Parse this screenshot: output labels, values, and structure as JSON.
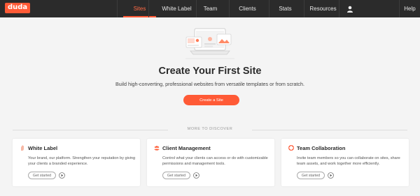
{
  "nav": {
    "logo": "duda",
    "items": [
      {
        "label": "Sites",
        "active": true
      },
      {
        "label": "White Label",
        "active": false
      },
      {
        "label": "Team",
        "active": false
      },
      {
        "label": "Clients",
        "active": false
      },
      {
        "label": "Stats",
        "active": false
      },
      {
        "label": "Resources",
        "active": false
      }
    ],
    "user_icon": "user-icon",
    "help_label": "Help"
  },
  "hero": {
    "title": "Create Your First Site",
    "subtitle": "Build high-converting, professional websites from versatile templates or from scratch.",
    "cta_label": "Create a Site"
  },
  "discover": {
    "label": "MORE TO DISCOVER"
  },
  "cards": [
    {
      "title": "White Label",
      "icon": "hand-icon",
      "description": "Your brand, our platform. Strengthen your reputation by giving your clients a branded experience.",
      "button_label": "Get started"
    },
    {
      "title": "Client Management",
      "icon": "people-icon",
      "description": "Control what your clients can access or do with customizable permissions and management tools.",
      "button_label": "Get started"
    },
    {
      "title": "Team Collaboration",
      "icon": "lifebuoy-icon",
      "description": "Invite team members so you can collaborate on sites, share team assets, and work together more efficiently.",
      "button_label": "Get started"
    }
  ],
  "colors": {
    "accent": "#ff5a36",
    "nav_bg": "#2b2b2b",
    "page_bg": "#f4f4f4"
  }
}
